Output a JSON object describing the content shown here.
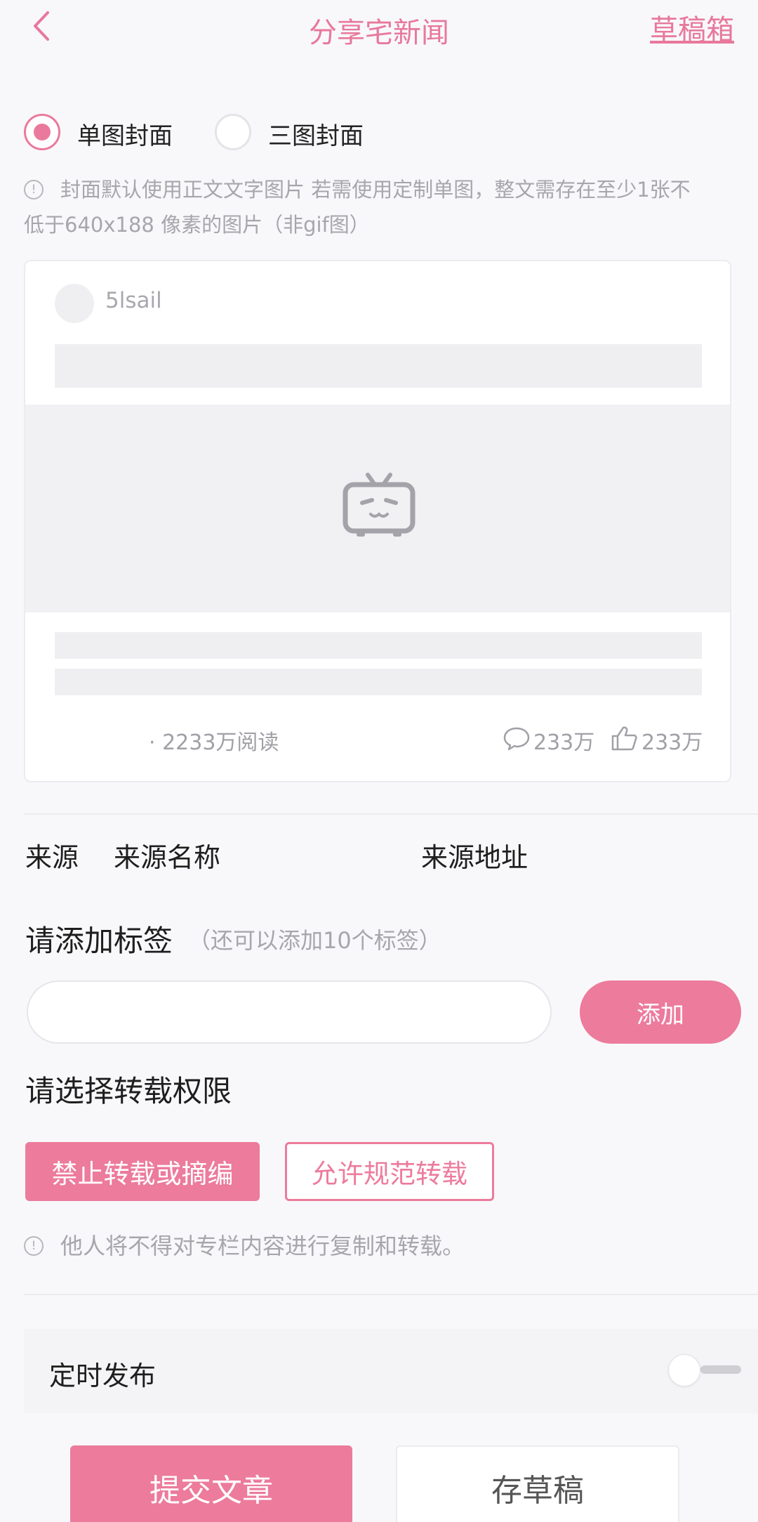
{
  "header": {
    "title": "分享宅新闻",
    "drafts_label": "草稿箱",
    "back_icon": "chevron-left-icon"
  },
  "cover_options": {
    "single_label": "单图封面",
    "triple_label": "三图封面",
    "selected": "single"
  },
  "cover_note": {
    "line1": "封面默认使用正文文字图片 若需使用定制单图，整文需存在至少1张不",
    "line2": "低于640x188 像素的图片（非gif图）"
  },
  "preview_card": {
    "username": "5lsail",
    "reads": "· 2233万阅读",
    "comments": "233万",
    "likes": "233万",
    "placeholder_icon": "bilibili-tv-icon"
  },
  "source": {
    "label": "来源",
    "name_placeholder": "来源名称",
    "url_placeholder": "来源地址"
  },
  "tags": {
    "title": "请添加标签",
    "hint": "（还可以添加10个标签）",
    "input_value": "",
    "add_label": "添加"
  },
  "permission": {
    "title": "请选择转载权限",
    "forbid_label": "禁止转载或摘编",
    "allow_label": "允许规范转载",
    "selected": "forbid",
    "note": "他人将不得对专栏内容进行复制和转载。"
  },
  "schedule": {
    "label": "定时发布",
    "enabled": false
  },
  "actions": {
    "submit_label": "提交文章",
    "save_draft_label": "存草稿"
  },
  "colors": {
    "accent": "#ec7b9c",
    "background": "#f8f8fa"
  }
}
